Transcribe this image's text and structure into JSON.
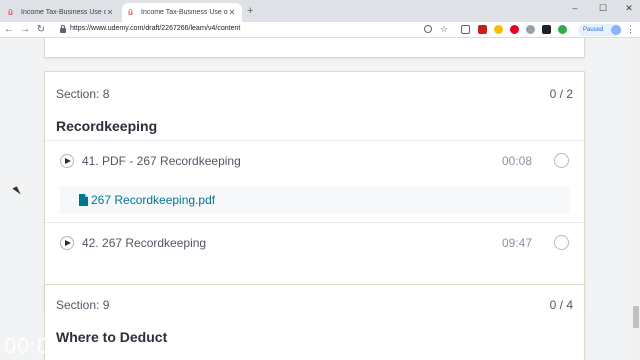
{
  "browser": {
    "tabs": [
      {
        "title": "Income Tax-Business Use of Hom",
        "active": false
      },
      {
        "title": "Income Tax-Business Use of Hom",
        "active": true
      }
    ],
    "new_tab": "+",
    "window_controls": {
      "minimize": "–",
      "maximize": "☐",
      "close": "✕"
    },
    "url": "https://www.udemy.com/draft/2267266/learn/v4/content",
    "profile_status": "Paused",
    "back": "←",
    "forward": "→",
    "reload": "↻"
  },
  "sections": [
    {
      "label": "Section: 8",
      "count": "0 / 2",
      "title": "Recordkeeping",
      "lectures": [
        {
          "title": "41. PDF - 267 Recordkeeping",
          "duration": "00:08"
        },
        {
          "title": "42. 267 Recordkeeping",
          "duration": "09:47"
        }
      ],
      "resource": {
        "name": "267 Recordkeeping.pdf"
      }
    },
    {
      "label": "Section: 9",
      "count": "0 / 4",
      "title": "Where to Deduct"
    }
  ],
  "video_overlay_time": "00:0",
  "colors": {
    "accent": "#007791",
    "brand": "#ec5252",
    "text": "#29303b"
  }
}
